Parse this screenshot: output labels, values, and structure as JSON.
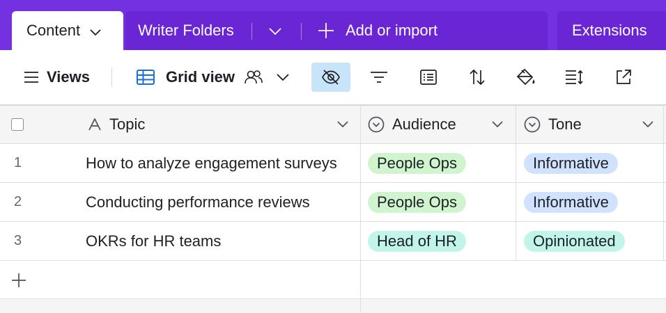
{
  "tabs": {
    "active": {
      "label": "Content"
    },
    "writer_folders": {
      "label": "Writer Folders"
    },
    "add_or_import": {
      "label": "Add or import"
    },
    "extensions": {
      "label": "Extensions"
    }
  },
  "toolbar": {
    "views_label": "Views",
    "view_name": "Grid view",
    "icons": [
      "hide-fields-icon",
      "filter-icon",
      "group-icon",
      "sort-icon",
      "color-icon",
      "row-height-icon",
      "share-icon"
    ]
  },
  "grid": {
    "columns": {
      "topic": "Topic",
      "audience": "Audience",
      "tone": "Tone"
    },
    "rows": [
      {
        "num": "1",
        "topic": "How to analyze engagement surveys",
        "audience": "People Ops",
        "tone": "Informative"
      },
      {
        "num": "2",
        "topic": "Conducting performance reviews",
        "audience": "People Ops",
        "tone": "Informative"
      },
      {
        "num": "3",
        "topic": "OKRs for HR teams",
        "audience": "Head of HR",
        "tone": "Opinionated"
      }
    ]
  },
  "colors": {
    "tabbar": "#7431e2",
    "pill_people_ops": "#d0f5ce",
    "pill_head_of_hr": "#c2f5e9",
    "pill_informative": "#d1e2ff",
    "pill_opinionated": "#c2f5e9",
    "active_icon_bg": "#c8e4f8"
  }
}
